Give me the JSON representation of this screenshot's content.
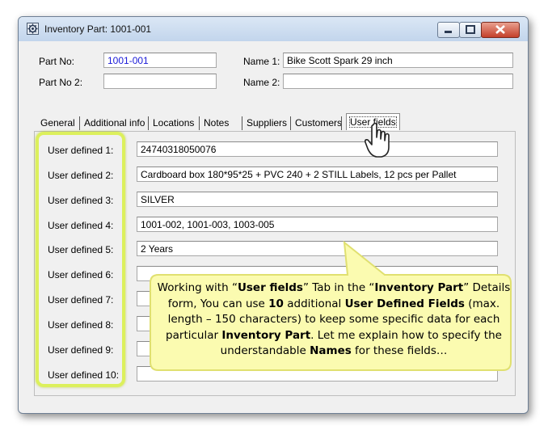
{
  "window": {
    "title": "Inventory Part: 1001-001"
  },
  "header": {
    "part_no_label": "Part No:",
    "part_no_value": "1001-001",
    "part_no2_label": "Part No 2:",
    "part_no2_value": "",
    "name1_label": "Name 1:",
    "name1_value": "Bike Scott Spark 29 inch",
    "name2_label": "Name 2:",
    "name2_value": ""
  },
  "tabs": [
    {
      "label": "General"
    },
    {
      "label": "Additional info"
    },
    {
      "label": "Locations"
    },
    {
      "label": "Notes"
    },
    {
      "label": "Suppliers"
    },
    {
      "label": "Customers"
    },
    {
      "label": "User fields"
    }
  ],
  "active_tab": "User fields",
  "user_fields": [
    {
      "label": "User defined 1:",
      "value": "24740318050076"
    },
    {
      "label": "User defined 2:",
      "value": "Cardboard box 180*95*25 + PVC 240 + 2 STILL Labels, 12 pcs per Pallet"
    },
    {
      "label": "User defined 3:",
      "value": "SILVER"
    },
    {
      "label": "User defined 4:",
      "value": "1001-002, 1001-003, 1003-005"
    },
    {
      "label": "User defined 5:",
      "value": "2 Years"
    },
    {
      "label": "User defined 6:",
      "value": ""
    },
    {
      "label": "User defined 7:",
      "value": ""
    },
    {
      "label": "User defined 8:",
      "value": ""
    },
    {
      "label": "User defined 9:",
      "value": ""
    },
    {
      "label": "User defined 10:",
      "value": ""
    }
  ],
  "callout": {
    "p1": "Working with “",
    "b1": "User fields",
    "p2": "” Tab in the “",
    "b2": "Inventory Part",
    "p3": "” Details form, You can use ",
    "b3": "10",
    "p4": " additional ",
    "b4": "User Defined Fields",
    "p5": " (max. length – 150 characters) to keep some specific data for each particular ",
    "b5": "Inventory Part",
    "p6": ". Let me explain how to specify the understandable ",
    "b6": "Names",
    "p7": " for these fields…"
  },
  "colors": {
    "highlight": "#dcf05c",
    "callout_fill": "#fbfbb0",
    "callout_border": "#e0e070",
    "part_no_text": "#1a1ad8"
  }
}
